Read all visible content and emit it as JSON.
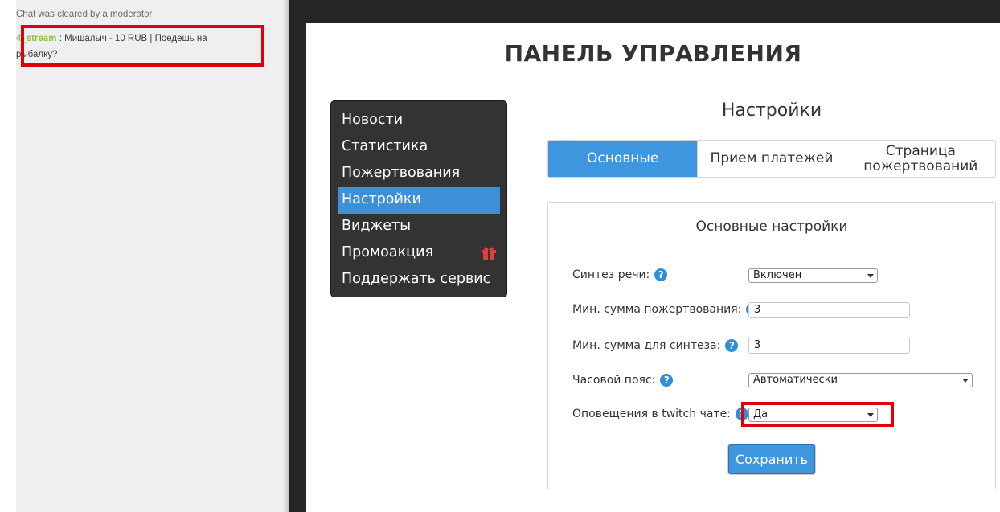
{
  "chat": {
    "system_message": "Chat was cleared by a moderator",
    "message": {
      "username": "4_stream",
      "separator": ":",
      "text": "Мишалыч - 10 RUB | Поедешь на рыбалку?"
    }
  },
  "header": {
    "title": "ПАНЕЛЬ УПРАВЛЕНИЯ"
  },
  "menu": {
    "items": [
      {
        "label": "Новости"
      },
      {
        "label": "Статистика"
      },
      {
        "label": "Пожертвования"
      },
      {
        "label": "Настройки",
        "active": true
      },
      {
        "label": "Виджеты"
      },
      {
        "label": "Промоакция",
        "icon": "gift-icon"
      },
      {
        "label": "Поддержать сервис"
      }
    ]
  },
  "settings": {
    "title": "Настройки",
    "tabs": [
      {
        "label": "Основные",
        "active": true
      },
      {
        "label": "Прием платежей"
      },
      {
        "label": "Страница пожертвований"
      }
    ],
    "section_title": "Основные настройки",
    "fields": {
      "speech": {
        "label": "Синтез речи:",
        "value": "Включен"
      },
      "min_donation": {
        "label": "Мин. сумма пожертвования:",
        "value": "3"
      },
      "min_synth": {
        "label": "Мин. сумма для синтеза:",
        "value": "3"
      },
      "timezone": {
        "label": "Часовой пояс:",
        "value": "Автоматически"
      },
      "twitch_alerts": {
        "label": "Оповещения в twitch чате:",
        "value": "Да"
      }
    },
    "help_glyph": "?",
    "save_label": "Сохранить"
  },
  "colors": {
    "accent": "#3d96de",
    "highlight": "#e0000b",
    "username": "#8bc34a",
    "menu_bg": "#333333"
  }
}
